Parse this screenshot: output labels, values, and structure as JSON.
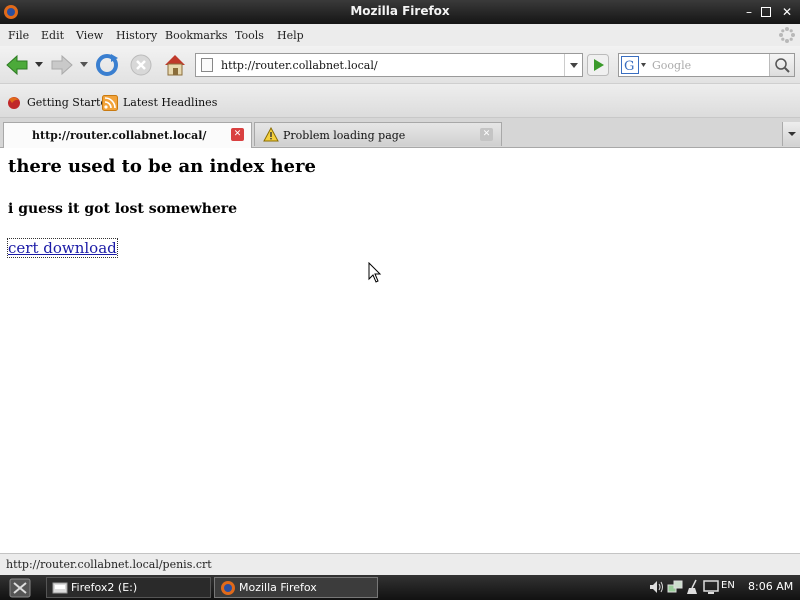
{
  "window": {
    "title": "Mozilla Firefox"
  },
  "menu": [
    "File",
    "Edit",
    "View",
    "History",
    "Bookmarks",
    "Tools",
    "Help"
  ],
  "navigation": {
    "url": "http://router.collabnet.local/",
    "search_placeholder": "Google"
  },
  "bookmarks": [
    {
      "label": "Getting Started",
      "icon": "firefox-bookmark-icon"
    },
    {
      "label": "Latest Headlines",
      "icon": "rss-feed-icon"
    }
  ],
  "tabs": [
    {
      "label": "http://router.collabnet.local/",
      "active": true
    },
    {
      "label": "Problem loading page",
      "active": false
    }
  ],
  "page": {
    "heading": "there used to be an index here",
    "subheading": "i guess it got lost somewhere",
    "link_text": "cert download"
  },
  "status": {
    "text": "http://router.collabnet.local/penis.crt"
  },
  "taskbar": {
    "tasks": [
      "Firefox2 (E:)",
      "Mozilla Firefox"
    ],
    "language": "EN",
    "clock": "8:06 AM"
  },
  "colors": {
    "link": "#1a1aa6",
    "close_active": "#d94040",
    "go_green": "#3a9a2a"
  }
}
